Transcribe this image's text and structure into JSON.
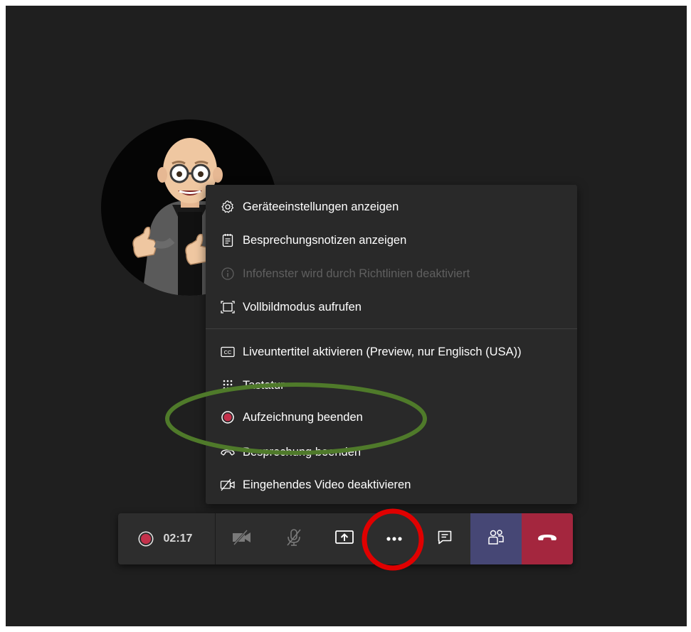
{
  "menu": {
    "items": [
      {
        "label": "Geräteeinstellungen anzeigen",
        "icon": "gear-icon"
      },
      {
        "label": "Besprechungsnotizen anzeigen",
        "icon": "notes-icon"
      },
      {
        "label": "Infofenster wird durch Richtlinien deaktiviert",
        "icon": "info-icon",
        "disabled": true
      },
      {
        "label": "Vollbildmodus aufrufen",
        "icon": "fullscreen-icon"
      },
      {
        "label": "Liveuntertitel aktivieren (Preview, nur Englisch (USA))",
        "icon": "closed-captions-icon"
      },
      {
        "label": "Tastatur",
        "icon": "dialpad-icon"
      },
      {
        "label": "Aufzeichnung beenden",
        "icon": "record-stop-icon"
      },
      {
        "label": "Besprechung beenden",
        "icon": "end-meeting-icon"
      },
      {
        "label": "Eingehendes Video deaktivieren",
        "icon": "video-off-icon"
      }
    ]
  },
  "toolbar": {
    "timer": "02:17",
    "buttons": [
      "camera-off-icon",
      "mic-off-icon",
      "share-screen-icon",
      "more-options-icon",
      "chat-icon",
      "participants-icon",
      "hang-up-icon"
    ]
  },
  "colors": {
    "background": "#1f1f1f",
    "menu": "#292929",
    "record": "#c4314b",
    "hangup": "#a4263e",
    "participants_active": "#464775",
    "highlight_ellipse": "#4f7a2a",
    "highlight_circle": "#e00000"
  }
}
